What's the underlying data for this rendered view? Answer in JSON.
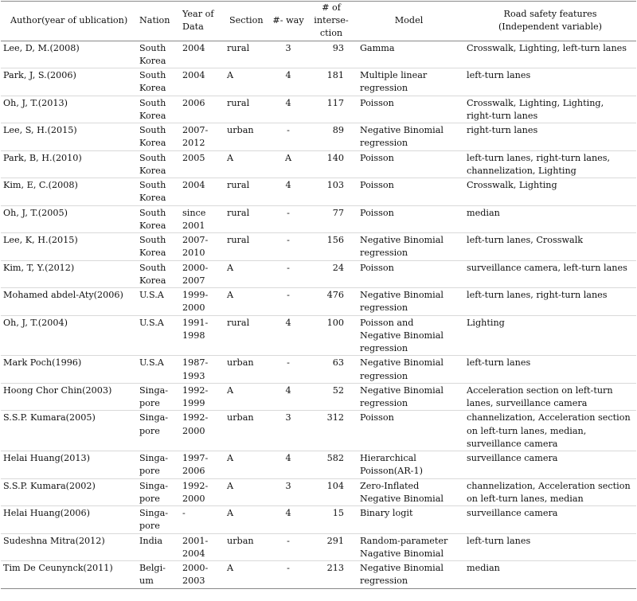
{
  "headers": {
    "author": "Author(year of ublication)",
    "nation": "Nation",
    "year": "Year of\nData",
    "section": "Section",
    "way": "#- way",
    "intersections": "# of\ninterse-\nction",
    "model": "Model",
    "features": "Road safety features\n(Independent variable)"
  },
  "rows": [
    {
      "author": "Lee, D, M.(2008)",
      "nation": "South\nKorea",
      "year": "2004",
      "section": "rural",
      "way": "3",
      "intersections": "93",
      "model": "Gamma",
      "features": "Crosswalk, Lighting, left-turn lanes"
    },
    {
      "author": "Park, J, S.(2006)",
      "nation": "South\nKorea",
      "year": "2004",
      "section": "A",
      "way": "4",
      "intersections": "181",
      "model": "Multiple linear\nregression",
      "features": "left-turn lanes"
    },
    {
      "author": "Oh, J, T.(2013)",
      "nation": "South\nKorea",
      "year": "2006",
      "section": "rural",
      "way": "4",
      "intersections": "117",
      "model": "Poisson",
      "features": "Crosswalk, Lighting, Lighting,\nright-turn lanes"
    },
    {
      "author": "Lee, S, H.(2015)",
      "nation": "South\nKorea",
      "year": "2007-\n2012",
      "section": "urban",
      "way": "-",
      "intersections": "89",
      "model": "Negative Binomial\nregression",
      "features": "right-turn lanes"
    },
    {
      "author": "Park, B, H.(2010)",
      "nation": "South\nKorea",
      "year": "2005",
      "section": "A",
      "way": "A",
      "intersections": "140",
      "model": "Poisson",
      "features": "left-turn lanes, right-turn lanes,\nchannelization, Lighting"
    },
    {
      "author": "Kim, E, C.(2008)",
      "nation": "South\nKorea",
      "year": "2004",
      "section": "rural",
      "way": "4",
      "intersections": "103",
      "model": "Poisson",
      "features": "Crosswalk, Lighting"
    },
    {
      "author": "Oh, J, T.(2005)",
      "nation": "South\nKorea",
      "year": "since\n2001",
      "section": "rural",
      "way": "-",
      "intersections": "77",
      "model": "Poisson",
      "features": "median"
    },
    {
      "author": "Lee, K, H.(2015)",
      "nation": "South\nKorea",
      "year": "2007-\n2010",
      "section": "rural",
      "way": "-",
      "intersections": "156",
      "model": "Negative Binomial\nregression",
      "features": "left-turn lanes, Crosswalk"
    },
    {
      "author": "Kim, T, Y.(2012)",
      "nation": "South\nKorea",
      "year": "2000-\n2007",
      "section": "A",
      "way": "-",
      "intersections": "24",
      "model": "Poisson",
      "features": "surveillance camera, left-turn lanes"
    },
    {
      "author": "Mohamed abdel-Aty(2006)",
      "nation": "U.S.A",
      "year": "1999-\n2000",
      "section": "A",
      "way": "-",
      "intersections": "476",
      "model": "Negative Binomial\nregression",
      "features": "left-turn lanes, right-turn lanes"
    },
    {
      "author": "Oh, J, T.(2004)",
      "nation": "U.S.A",
      "year": "1991-\n1998",
      "section": "rural",
      "way": "4",
      "intersections": "100",
      "model": "Poisson and\nNegative Binomial\nregression",
      "features": "Lighting"
    },
    {
      "author": "Mark Poch(1996)",
      "nation": "U.S.A",
      "year": "1987-\n1993",
      "section": "urban",
      "way": "-",
      "intersections": "63",
      "model": "Negative Binomial\nregression",
      "features": "left-turn lanes"
    },
    {
      "author": "Hoong Chor Chin(2003)",
      "nation": "Singa-\npore",
      "year": "1992-\n1999",
      "section": "A",
      "way": "4",
      "intersections": "52",
      "model": "Negative Binomial\nregression",
      "features": "Acceleration section on left-turn\nlanes, surveillance camera"
    },
    {
      "author": "S.S.P. Kumara(2005)",
      "nation": "Singa-\npore",
      "year": "1992-\n2000",
      "section": "urban",
      "way": "3",
      "intersections": "312",
      "model": "Poisson",
      "features": "channelization, Acceleration section\non left-turn lanes, median,\nsurveillance camera"
    },
    {
      "author": "Helai Huang(2013)",
      "nation": "Singa-\npore",
      "year": "1997-\n2006",
      "section": "A",
      "way": "4",
      "intersections": "582",
      "model": "Hierarchical\nPoisson(AR-1)",
      "features": "surveillance camera"
    },
    {
      "author": "S.S.P. Kumara(2002)",
      "nation": "Singa-\npore",
      "year": "1992-\n2000",
      "section": "A",
      "way": "3",
      "intersections": "104",
      "model": "Zero-Inflated\nNegative Binomial",
      "features": "channelization, Acceleration section\non left-turn lanes, median"
    },
    {
      "author": "Helai Huang(2006)",
      "nation": "Singa-\npore",
      "year": "-",
      "section": "A",
      "way": "4",
      "intersections": "15",
      "model": "Binary logit",
      "features": "surveillance camera"
    },
    {
      "author": "Sudeshna Mitra(2012)",
      "nation": "India",
      "year": "2001-\n2004",
      "section": "urban",
      "way": "-",
      "intersections": "291",
      "model": "Random-parameter\nNagative Binomial",
      "features": "left-turn lanes"
    },
    {
      "author": "Tim De Ceunynck(2011)",
      "nation": "Belgi-\num",
      "year": "2000-\n2003",
      "section": "A",
      "way": "-",
      "intersections": "213",
      "model": "Negative Binomial\nregression",
      "features": "median"
    }
  ]
}
